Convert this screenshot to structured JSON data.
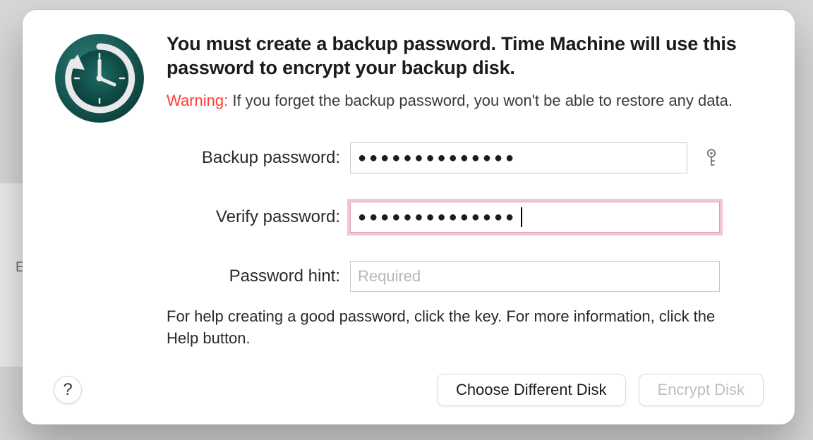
{
  "background": {
    "partial_letter": "E"
  },
  "dialog": {
    "title": "You must create a backup password. Time Machine will use this password to encrypt your backup disk.",
    "warning_label": "Warning:",
    "warning_text": " If you forget the backup password, you won't be able to restore any data.",
    "fields": {
      "backup_password": {
        "label": "Backup password:",
        "value": "●●●●●●●●●●●●●●"
      },
      "verify_password": {
        "label": "Verify password:",
        "value": "●●●●●●●●●●●●●●"
      },
      "password_hint": {
        "label": "Password hint:",
        "value": "",
        "placeholder": "Required"
      }
    },
    "help_text": "For help creating a good password, click the key. For more information, click the Help button.",
    "buttons": {
      "help": "?",
      "choose_different": "Choose Different Disk",
      "encrypt": "Encrypt Disk"
    },
    "icon_name": "time-machine-icon",
    "key_icon_name": "key-icon"
  },
  "colors": {
    "warning": "#ff3b30",
    "focus_ring": "#e896b9",
    "tm_icon_bg": "#124b48"
  }
}
